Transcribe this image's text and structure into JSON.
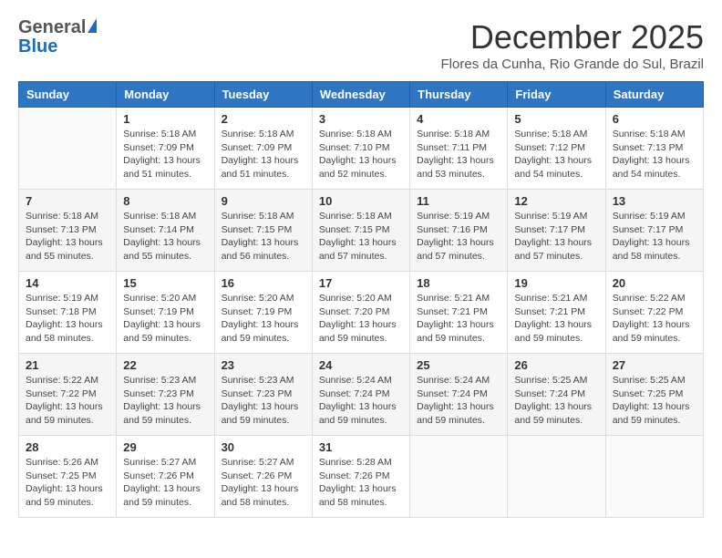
{
  "header": {
    "logo_general": "General",
    "logo_blue": "Blue",
    "month_title": "December 2025",
    "location": "Flores da Cunha, Rio Grande do Sul, Brazil"
  },
  "weekdays": [
    "Sunday",
    "Monday",
    "Tuesday",
    "Wednesday",
    "Thursday",
    "Friday",
    "Saturday"
  ],
  "weeks": [
    [
      {
        "day": "",
        "sunrise": "",
        "sunset": "",
        "daylight": ""
      },
      {
        "day": "1",
        "sunrise": "Sunrise: 5:18 AM",
        "sunset": "Sunset: 7:09 PM",
        "daylight": "Daylight: 13 hours and 51 minutes."
      },
      {
        "day": "2",
        "sunrise": "Sunrise: 5:18 AM",
        "sunset": "Sunset: 7:09 PM",
        "daylight": "Daylight: 13 hours and 51 minutes."
      },
      {
        "day": "3",
        "sunrise": "Sunrise: 5:18 AM",
        "sunset": "Sunset: 7:10 PM",
        "daylight": "Daylight: 13 hours and 52 minutes."
      },
      {
        "day": "4",
        "sunrise": "Sunrise: 5:18 AM",
        "sunset": "Sunset: 7:11 PM",
        "daylight": "Daylight: 13 hours and 53 minutes."
      },
      {
        "day": "5",
        "sunrise": "Sunrise: 5:18 AM",
        "sunset": "Sunset: 7:12 PM",
        "daylight": "Daylight: 13 hours and 54 minutes."
      },
      {
        "day": "6",
        "sunrise": "Sunrise: 5:18 AM",
        "sunset": "Sunset: 7:13 PM",
        "daylight": "Daylight: 13 hours and 54 minutes."
      }
    ],
    [
      {
        "day": "7",
        "sunrise": "Sunrise: 5:18 AM",
        "sunset": "Sunset: 7:13 PM",
        "daylight": "Daylight: 13 hours and 55 minutes."
      },
      {
        "day": "8",
        "sunrise": "Sunrise: 5:18 AM",
        "sunset": "Sunset: 7:14 PM",
        "daylight": "Daylight: 13 hours and 55 minutes."
      },
      {
        "day": "9",
        "sunrise": "Sunrise: 5:18 AM",
        "sunset": "Sunset: 7:15 PM",
        "daylight": "Daylight: 13 hours and 56 minutes."
      },
      {
        "day": "10",
        "sunrise": "Sunrise: 5:18 AM",
        "sunset": "Sunset: 7:15 PM",
        "daylight": "Daylight: 13 hours and 57 minutes."
      },
      {
        "day": "11",
        "sunrise": "Sunrise: 5:19 AM",
        "sunset": "Sunset: 7:16 PM",
        "daylight": "Daylight: 13 hours and 57 minutes."
      },
      {
        "day": "12",
        "sunrise": "Sunrise: 5:19 AM",
        "sunset": "Sunset: 7:17 PM",
        "daylight": "Daylight: 13 hours and 57 minutes."
      },
      {
        "day": "13",
        "sunrise": "Sunrise: 5:19 AM",
        "sunset": "Sunset: 7:17 PM",
        "daylight": "Daylight: 13 hours and 58 minutes."
      }
    ],
    [
      {
        "day": "14",
        "sunrise": "Sunrise: 5:19 AM",
        "sunset": "Sunset: 7:18 PM",
        "daylight": "Daylight: 13 hours and 58 minutes."
      },
      {
        "day": "15",
        "sunrise": "Sunrise: 5:20 AM",
        "sunset": "Sunset: 7:19 PM",
        "daylight": "Daylight: 13 hours and 59 minutes."
      },
      {
        "day": "16",
        "sunrise": "Sunrise: 5:20 AM",
        "sunset": "Sunset: 7:19 PM",
        "daylight": "Daylight: 13 hours and 59 minutes."
      },
      {
        "day": "17",
        "sunrise": "Sunrise: 5:20 AM",
        "sunset": "Sunset: 7:20 PM",
        "daylight": "Daylight: 13 hours and 59 minutes."
      },
      {
        "day": "18",
        "sunrise": "Sunrise: 5:21 AM",
        "sunset": "Sunset: 7:21 PM",
        "daylight": "Daylight: 13 hours and 59 minutes."
      },
      {
        "day": "19",
        "sunrise": "Sunrise: 5:21 AM",
        "sunset": "Sunset: 7:21 PM",
        "daylight": "Daylight: 13 hours and 59 minutes."
      },
      {
        "day": "20",
        "sunrise": "Sunrise: 5:22 AM",
        "sunset": "Sunset: 7:22 PM",
        "daylight": "Daylight: 13 hours and 59 minutes."
      }
    ],
    [
      {
        "day": "21",
        "sunrise": "Sunrise: 5:22 AM",
        "sunset": "Sunset: 7:22 PM",
        "daylight": "Daylight: 13 hours and 59 minutes."
      },
      {
        "day": "22",
        "sunrise": "Sunrise: 5:23 AM",
        "sunset": "Sunset: 7:23 PM",
        "daylight": "Daylight: 13 hours and 59 minutes."
      },
      {
        "day": "23",
        "sunrise": "Sunrise: 5:23 AM",
        "sunset": "Sunset: 7:23 PM",
        "daylight": "Daylight: 13 hours and 59 minutes."
      },
      {
        "day": "24",
        "sunrise": "Sunrise: 5:24 AM",
        "sunset": "Sunset: 7:24 PM",
        "daylight": "Daylight: 13 hours and 59 minutes."
      },
      {
        "day": "25",
        "sunrise": "Sunrise: 5:24 AM",
        "sunset": "Sunset: 7:24 PM",
        "daylight": "Daylight: 13 hours and 59 minutes."
      },
      {
        "day": "26",
        "sunrise": "Sunrise: 5:25 AM",
        "sunset": "Sunset: 7:24 PM",
        "daylight": "Daylight: 13 hours and 59 minutes."
      },
      {
        "day": "27",
        "sunrise": "Sunrise: 5:25 AM",
        "sunset": "Sunset: 7:25 PM",
        "daylight": "Daylight: 13 hours and 59 minutes."
      }
    ],
    [
      {
        "day": "28",
        "sunrise": "Sunrise: 5:26 AM",
        "sunset": "Sunset: 7:25 PM",
        "daylight": "Daylight: 13 hours and 59 minutes."
      },
      {
        "day": "29",
        "sunrise": "Sunrise: 5:27 AM",
        "sunset": "Sunset: 7:26 PM",
        "daylight": "Daylight: 13 hours and 59 minutes."
      },
      {
        "day": "30",
        "sunrise": "Sunrise: 5:27 AM",
        "sunset": "Sunset: 7:26 PM",
        "daylight": "Daylight: 13 hours and 58 minutes."
      },
      {
        "day": "31",
        "sunrise": "Sunrise: 5:28 AM",
        "sunset": "Sunset: 7:26 PM",
        "daylight": "Daylight: 13 hours and 58 minutes."
      },
      {
        "day": "",
        "sunrise": "",
        "sunset": "",
        "daylight": ""
      },
      {
        "day": "",
        "sunrise": "",
        "sunset": "",
        "daylight": ""
      },
      {
        "day": "",
        "sunrise": "",
        "sunset": "",
        "daylight": ""
      }
    ]
  ]
}
